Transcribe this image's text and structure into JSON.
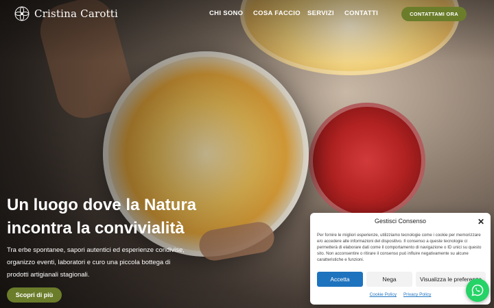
{
  "brand": {
    "name": "Cristina Carotti",
    "accent": "#6b7d2a"
  },
  "nav": {
    "items": [
      {
        "label": "CHI SONO"
      },
      {
        "label": "COSA FACCIO"
      },
      {
        "label": "SERVIZI"
      },
      {
        "label": "CONTATTI"
      }
    ],
    "cta_label": "CONTATTAMI ORA"
  },
  "hero": {
    "title": "Un luogo dove la Natura incontra la convivialità",
    "description": "Tra erbe spontanee, sapori autentici ed esperienze condivise, organizzo eventi, laboratori e curo una piccola bottega di prodotti artigianali stagionali.",
    "button_label": "Scopri di più"
  },
  "consent": {
    "title": "Gestisci Consenso",
    "text": "Per fornire le migliori esperienze, utilizziamo tecnologie come i cookie per memorizzare e/o accedere alle informazioni del dispositivo. Il consenso a queste tecnologie ci permetterà di elaborare dati come il comportamento di navigazione o ID unici su questo sito. Non acconsentire o ritirare il consenso può influire negativamente su alcune caratteristiche e funzioni.",
    "accept_label": "Accetta",
    "deny_label": "Nega",
    "prefs_label": "Visualizza le preferenze",
    "cookie_policy": "Cookie Policy",
    "privacy_policy": "Privacy Policy",
    "accept_color": "#1e73be"
  },
  "whatsapp": {
    "icon": "whatsapp-icon",
    "color": "#25d366"
  }
}
